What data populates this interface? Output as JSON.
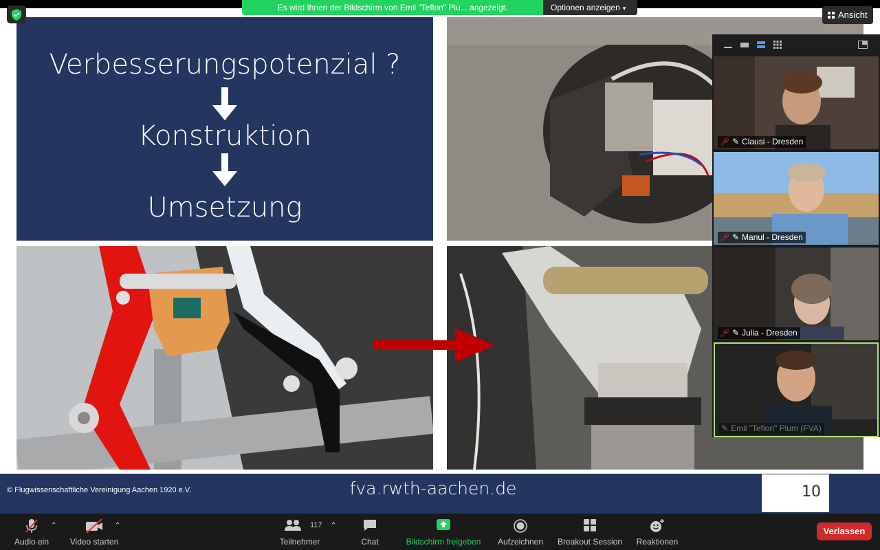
{
  "share_banner": {
    "message": "Es wird Ihnen der Bildschirm von Emil \"Teflon\" Plu... angezeigt.",
    "options_label": "Optionen anzeigen"
  },
  "view_button": {
    "label": "Ansicht"
  },
  "slide": {
    "lines": [
      "Verbesserungspotenzial ?",
      "Konstruktion",
      "Umsetzung"
    ],
    "copyright": "© Flugwissenschaftliche Vereinigung Aachen 1920 e.V.",
    "url": "fva.rwth-aachen.de",
    "page_number": "10",
    "colors": {
      "panel_navy": "#24365f",
      "arrow_red": "#c00000"
    }
  },
  "participants": [
    {
      "name": "Clausi - Dresden",
      "muted": true,
      "pinned": true
    },
    {
      "name": "Manul - Dresden",
      "muted": true,
      "pinned": true
    },
    {
      "name": "Julia - Dresden",
      "muted": true,
      "pinned": true
    },
    {
      "name": "Emil \"Teflon\" Plum (FVA)",
      "muted": false,
      "pinned": true,
      "active_speaker": true
    }
  ],
  "toolbar": {
    "audio_label": "Audio ein",
    "video_label": "Video starten",
    "participants_label": "Teilnehmer",
    "participants_count": "117",
    "chat_label": "Chat",
    "share_label": "Bildschirm freigeben",
    "record_label": "Aufzeichnen",
    "breakout_label": "Breakout Session",
    "reactions_label": "Reaktionen",
    "leave_label": "Verlassen"
  },
  "colors": {
    "share_green": "#23d35f",
    "leave_red": "#d02a2a",
    "speaker_highlight": "#b2e26e"
  }
}
